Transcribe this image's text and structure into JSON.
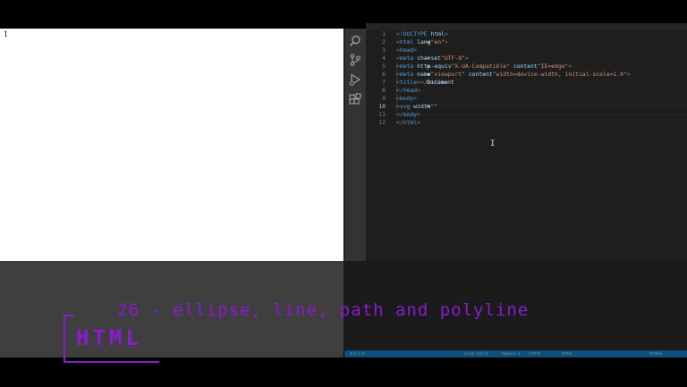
{
  "preview": {
    "content": "1"
  },
  "editor": {
    "lines": [
      {
        "n": "1",
        "parts": [
          [
            "bracket",
            "<!"
          ],
          [
            "tag",
            "DOCTYPE"
          ],
          [
            "attr",
            " html"
          ],
          [
            "bracket",
            ">"
          ]
        ]
      },
      {
        "n": "2",
        "parts": [
          [
            "bracket",
            "<"
          ],
          [
            "tag",
            "html"
          ],
          [
            "attr",
            " lang"
          ],
          [
            "txt",
            "="
          ],
          [
            "str",
            "\"en\""
          ],
          [
            "bracket",
            ">"
          ]
        ]
      },
      {
        "n": "3",
        "parts": [
          [
            "bracket",
            "<"
          ],
          [
            "tag",
            "head"
          ],
          [
            "bracket",
            ">"
          ]
        ]
      },
      {
        "n": "4",
        "parts": [
          [
            "txt",
            "    "
          ],
          [
            "bracket",
            "<"
          ],
          [
            "tag",
            "meta"
          ],
          [
            "attr",
            " charset"
          ],
          [
            "txt",
            "="
          ],
          [
            "str",
            "\"UTF-8\""
          ],
          [
            "bracket",
            ">"
          ]
        ]
      },
      {
        "n": "5",
        "parts": [
          [
            "txt",
            "    "
          ],
          [
            "bracket",
            "<"
          ],
          [
            "tag",
            "meta"
          ],
          [
            "attr",
            " http-equiv"
          ],
          [
            "txt",
            "="
          ],
          [
            "str",
            "\"X-UA-Compatible\""
          ],
          [
            "attr",
            " content"
          ],
          [
            "txt",
            "="
          ],
          [
            "str",
            "\"IE=edge\""
          ],
          [
            "bracket",
            ">"
          ]
        ]
      },
      {
        "n": "6",
        "parts": [
          [
            "txt",
            "    "
          ],
          [
            "bracket",
            "<"
          ],
          [
            "tag",
            "meta"
          ],
          [
            "attr",
            " name"
          ],
          [
            "txt",
            "="
          ],
          [
            "str",
            "\"viewport\""
          ],
          [
            "attr",
            " content"
          ],
          [
            "txt",
            "="
          ],
          [
            "str",
            "\"width=device-width, initial-scale=1.0\""
          ],
          [
            "bracket",
            ">"
          ]
        ]
      },
      {
        "n": "7",
        "parts": [
          [
            "txt",
            "    "
          ],
          [
            "bracket",
            "<"
          ],
          [
            "tag",
            "title"
          ],
          [
            "bracket",
            ">"
          ],
          [
            "txt",
            "Document"
          ],
          [
            "bracket",
            "</"
          ],
          [
            "tag",
            "title"
          ],
          [
            "bracket",
            ">"
          ]
        ]
      },
      {
        "n": "8",
        "parts": [
          [
            "bracket",
            "</"
          ],
          [
            "tag",
            "head"
          ],
          [
            "bracket",
            ">"
          ]
        ]
      },
      {
        "n": "9",
        "parts": [
          [
            "bracket",
            "<"
          ],
          [
            "tag",
            "body"
          ],
          [
            "bracket",
            ">"
          ]
        ]
      },
      {
        "n": "10",
        "parts": [
          [
            "txt",
            "    "
          ],
          [
            "bracket",
            "<"
          ],
          [
            "tag",
            "svg"
          ],
          [
            "attr",
            " width"
          ],
          [
            "txt",
            "="
          ],
          [
            "str",
            "\"\""
          ]
        ]
      },
      {
        "n": "11",
        "parts": [
          [
            "bracket",
            "</"
          ],
          [
            "tag",
            "body"
          ],
          [
            "bracket",
            ">"
          ]
        ]
      },
      {
        "n": "12",
        "parts": [
          [
            "bracket",
            "</"
          ],
          [
            "tag",
            "html"
          ],
          [
            "bracket",
            ">"
          ]
        ]
      }
    ],
    "active_line": "10"
  },
  "statusbar": {
    "errors": "⊗ 0  ⚠ 0",
    "position": "Ln 10, Col 17",
    "spaces": "Spaces: 4",
    "encoding": "UTF-8",
    "language": "HTML",
    "prettier": "Prettier"
  },
  "overlay": {
    "title": "26 - ellipse, line, path and polyline",
    "badge": "HTML"
  },
  "colors": {
    "accent": "#8b1bd0",
    "editor_bg": "#1e1e1e",
    "activity_bg": "#333333",
    "statusbar": "#007acc"
  },
  "icons": [
    "search-icon",
    "source-control-icon",
    "run-debug-icon",
    "extensions-icon",
    "settings-gear-icon"
  ]
}
